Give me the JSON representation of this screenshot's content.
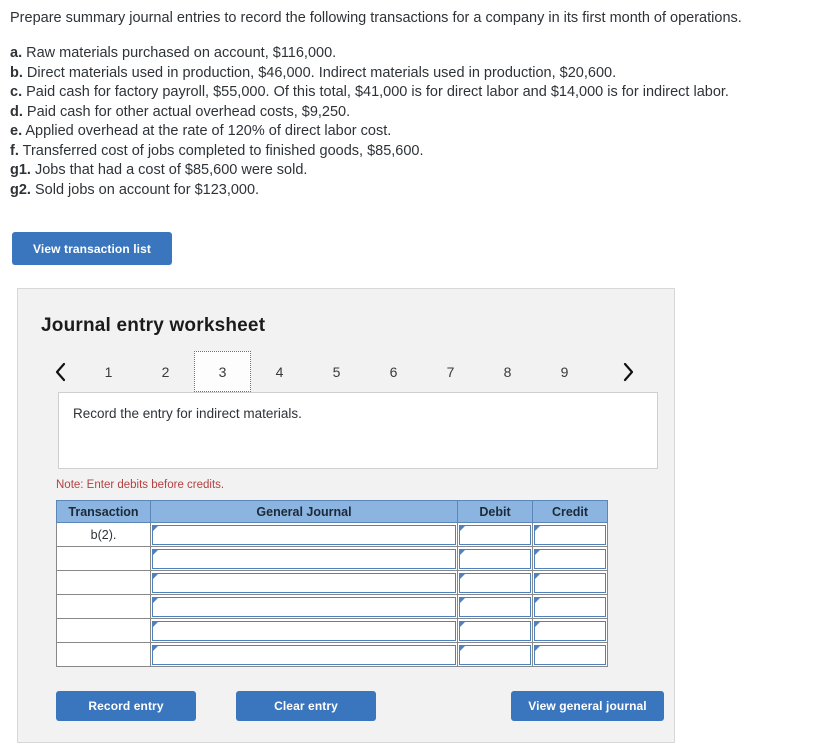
{
  "prompt": {
    "lead": "Prepare summary journal entries to record the following transactions for a company in its first month of operations.",
    "facts": [
      {
        "key": "a.",
        "text": "Raw materials purchased on account, $116,000."
      },
      {
        "key": "b.",
        "text": "Direct materials used in production, $46,000. Indirect materials used in production, $20,600."
      },
      {
        "key": "c.",
        "text": "Paid cash for factory payroll, $55,000. Of this total, $41,000 is for direct labor and $14,000 is for indirect labor."
      },
      {
        "key": "d.",
        "text": "Paid cash for other actual overhead costs, $9,250."
      },
      {
        "key": "e.",
        "text": "Applied overhead at the rate of 120% of direct labor cost."
      },
      {
        "key": "f.",
        "text": "Transferred cost of jobs completed to finished goods, $85,600."
      },
      {
        "key": "g1.",
        "text": "Jobs that had a cost of $85,600 were sold."
      },
      {
        "key": "g2.",
        "text": "Sold jobs on account for $123,000."
      }
    ]
  },
  "toolbar": {
    "view_transaction_list_label": "View transaction list"
  },
  "worksheet": {
    "title": "Journal entry worksheet",
    "pager": {
      "prev_icon": "chevron-left-icon",
      "next_icon": "chevron-right-icon",
      "pages": [
        "1",
        "2",
        "3",
        "4",
        "5",
        "6",
        "7",
        "8",
        "9"
      ],
      "active_page": "3"
    },
    "instruction": "Record the entry for indirect materials.",
    "note": "Note: Enter debits before credits.",
    "table": {
      "headers": [
        "Transaction",
        "General Journal",
        "Debit",
        "Credit"
      ],
      "rows": [
        {
          "transaction": "b(2).",
          "general_journal": "",
          "debit": "",
          "credit": ""
        },
        {
          "transaction": "",
          "general_journal": "",
          "debit": "",
          "credit": ""
        },
        {
          "transaction": "",
          "general_journal": "",
          "debit": "",
          "credit": ""
        },
        {
          "transaction": "",
          "general_journal": "",
          "debit": "",
          "credit": ""
        },
        {
          "transaction": "",
          "general_journal": "",
          "debit": "",
          "credit": ""
        },
        {
          "transaction": "",
          "general_journal": "",
          "debit": "",
          "credit": ""
        }
      ]
    },
    "actions": {
      "record_entry_label": "Record entry",
      "clear_entry_label": "Clear entry",
      "view_general_journal_label": "View general journal"
    }
  },
  "colors": {
    "button_blue": "#3a76bd",
    "table_header_blue": "#8cb4e0",
    "field_border_blue": "#4f81bd",
    "note_red": "#b5413f",
    "panel_bg": "#f2f2f2"
  }
}
